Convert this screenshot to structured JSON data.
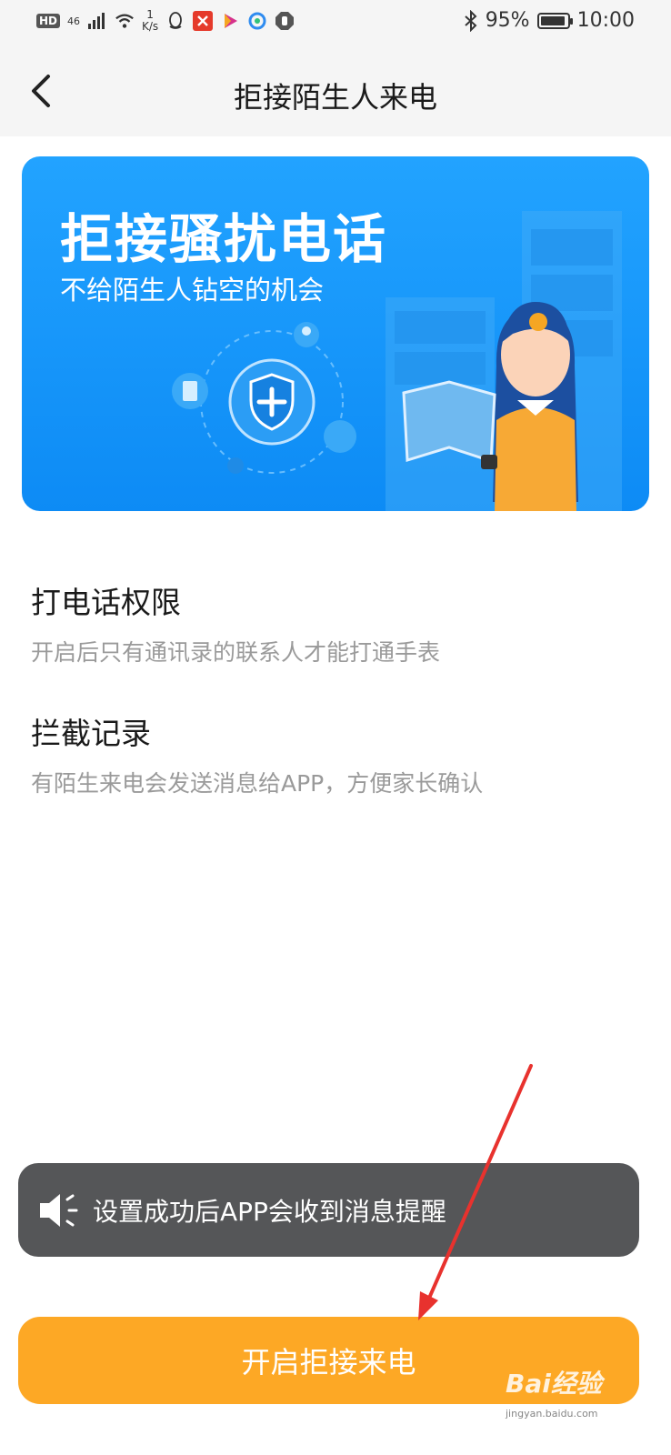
{
  "status_bar": {
    "hd": "HD",
    "network": "46",
    "speed_value": "1",
    "speed_unit": "K/s",
    "battery": "95%",
    "battery_level": 0.95,
    "time": "10:00"
  },
  "header": {
    "title": "拒接陌生人来电"
  },
  "banner": {
    "title": "拒接骚扰电话",
    "subtitle": "不给陌生人钻空的机会"
  },
  "settings": [
    {
      "title": "打电话权限",
      "description": "开启后只有通讯录的联系人才能打通手表"
    },
    {
      "title": "拦截记录",
      "description": "有陌生来电会发送消息给APP，方便家长确认"
    }
  ],
  "toast": {
    "text": "设置成功后APP会收到消息提醒"
  },
  "action": {
    "label": "开启拒接来电"
  },
  "watermark": {
    "main": "Bai经验",
    "sub": "jingyan.baidu.com"
  },
  "colors": {
    "banner_blue": "#1b9bfa",
    "button_orange": "#fda825",
    "toast_gray": "#555658",
    "annotation_red": "#e8322e"
  }
}
